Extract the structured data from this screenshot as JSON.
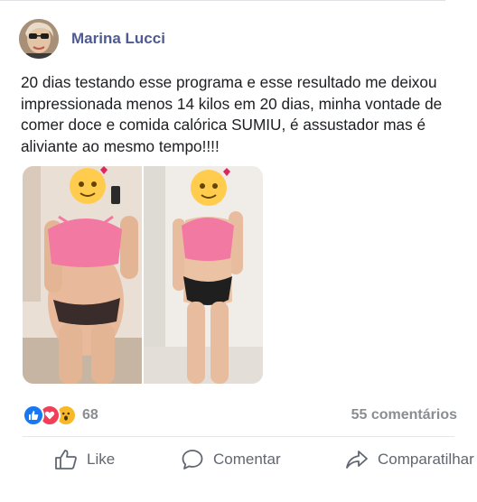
{
  "post": {
    "author": "Marina Lucci",
    "text": "20 dias testando esse programa e esse resultado me deixou impressionada menos 14 kilos em 20 dias, minha vontade de comer doce e comida calórica SUMIU, é assustador mas é aliviante ao mesmo tempo!!!!"
  },
  "reactions": {
    "icons": [
      "like-icon",
      "love-icon",
      "wow-icon"
    ],
    "count": "68"
  },
  "comments_count": "55 comentários",
  "actions": {
    "like_label": "Like",
    "comment_label": "Comentar",
    "share_label": "Comparatilhar"
  },
  "colors": {
    "author_name": "#4e5b93",
    "meta_text": "#8a8d91",
    "like_blue": "#1877f2",
    "love_red": "#f33e58",
    "wow_yellow": "#f7b928",
    "top_pink": "#f279a1"
  }
}
